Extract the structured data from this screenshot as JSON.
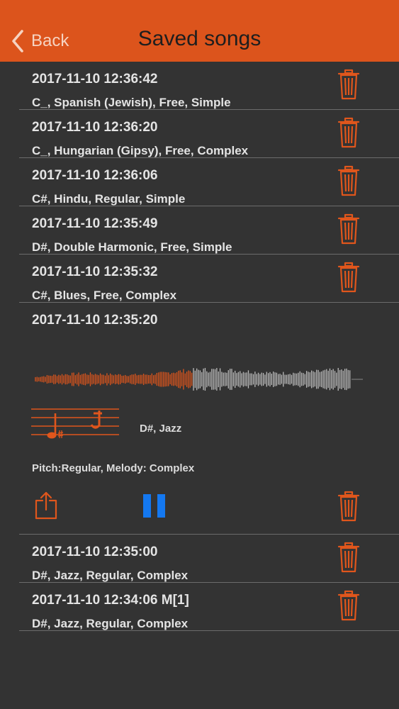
{
  "navbar": {
    "back_label": "Back",
    "title": "Saved songs"
  },
  "colors": {
    "accent": "#dc541c",
    "icon": "#e0561c",
    "pause": "#1478f0",
    "background": "#333333"
  },
  "songs": [
    {
      "date": "2017-11-10 12:36:42",
      "info": "C_, Spanish (Jewish), Free, Simple"
    },
    {
      "date": "2017-11-10 12:36:20",
      "info": "C_, Hungarian (Gipsy), Free, Complex"
    },
    {
      "date": "2017-11-10 12:36:06",
      "info": "C#, Hindu, Regular, Simple"
    },
    {
      "date": "2017-11-10 12:35:49",
      "info": "D#, Double Harmonic, Free, Simple"
    },
    {
      "date": "2017-11-10 12:35:32",
      "info": "C#, Blues, Free, Complex"
    }
  ],
  "expanded": {
    "date": "2017-11-10 12:35:20",
    "key_scale": "D#, Jazz",
    "pitch_melody": "Pitch:Regular, Melody: Complex",
    "playback_progress": 0.5,
    "playing": true
  },
  "songs_after": [
    {
      "date": "2017-11-10 12:35:00",
      "info": "D#, Jazz, Regular, Complex"
    },
    {
      "date": "2017-11-10 12:34:06 M[1]",
      "info": "D#, Jazz, Regular, Complex"
    }
  ],
  "icons": {
    "back": "chevron-left-icon",
    "delete": "trash-icon",
    "share": "share-icon",
    "pause": "pause-icon",
    "notation": "music-staff-icon",
    "waveform": "waveform-icon"
  }
}
